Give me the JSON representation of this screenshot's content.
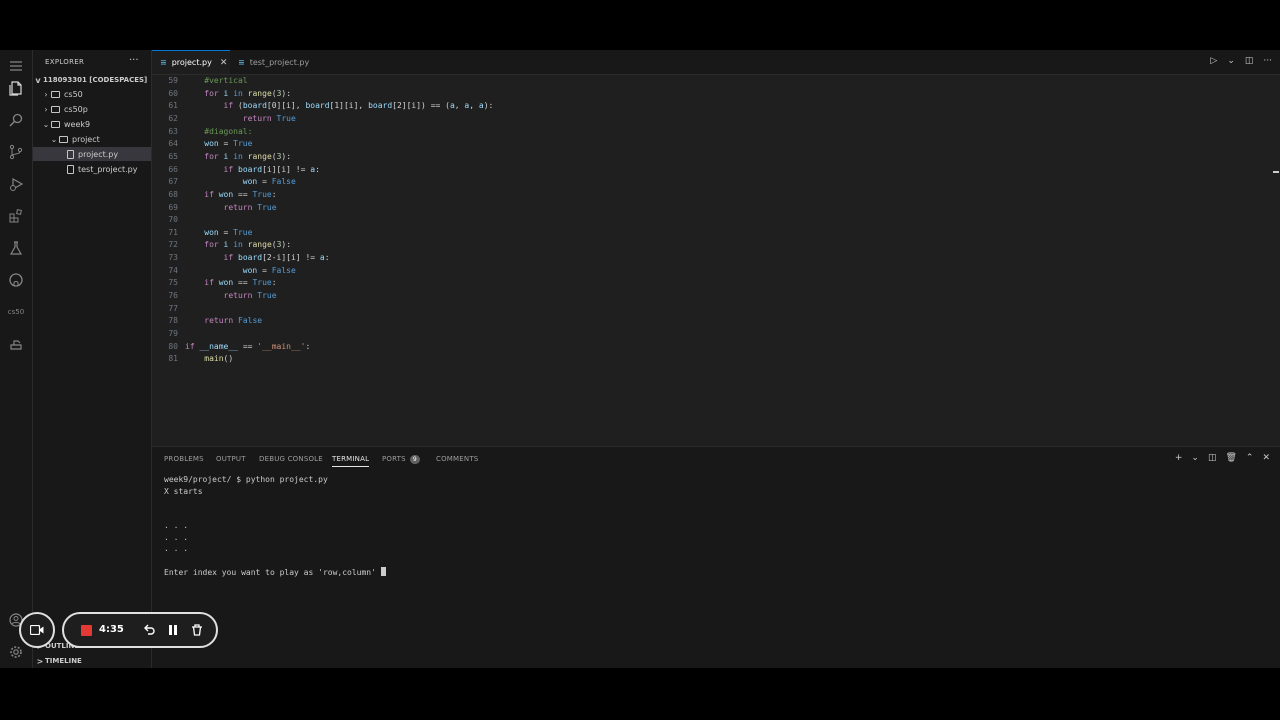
{
  "sidebar": {
    "title": "EXPLORER",
    "more": "···",
    "root": "118093301 [CODESPACES]",
    "items": [
      {
        "label": "cs50",
        "depth": 1,
        "kind": "folder",
        "chev": ">"
      },
      {
        "label": "cs50p",
        "depth": 1,
        "kind": "folder",
        "chev": ">"
      },
      {
        "label": "week9",
        "depth": 1,
        "kind": "folder",
        "chev": "v"
      },
      {
        "label": "project",
        "depth": 2,
        "kind": "folder",
        "chev": "v"
      },
      {
        "label": "project.py",
        "depth": 3,
        "kind": "file",
        "chev": ""
      },
      {
        "label": "test_project.py",
        "depth": 3,
        "kind": "file",
        "chev": ""
      }
    ],
    "outline": "OUTLINE",
    "timeline": "TIMELINE"
  },
  "activity": {
    "cs50_label": "cs50"
  },
  "tabs": [
    {
      "label": "project.py",
      "active": true,
      "close": "✕",
      "icon": "py"
    },
    {
      "label": "test_project.py",
      "active": false,
      "icon": "py"
    }
  ],
  "editor": {
    "lines": [
      {
        "n": "59",
        "tokens": [
          [
            "    ",
            "plain"
          ],
          [
            "#vertical",
            "cmt"
          ]
        ]
      },
      {
        "n": "60",
        "tokens": [
          [
            "    ",
            "plain"
          ],
          [
            "for",
            "kw"
          ],
          [
            " ",
            "plain"
          ],
          [
            "i",
            "var"
          ],
          [
            " ",
            "plain"
          ],
          [
            "in",
            "ctl"
          ],
          [
            " ",
            "plain"
          ],
          [
            "range",
            "fn"
          ],
          [
            "(",
            "plain"
          ],
          [
            "3",
            "num"
          ],
          [
            "):",
            "plain"
          ]
        ]
      },
      {
        "n": "61",
        "tokens": [
          [
            "        ",
            "plain"
          ],
          [
            "if",
            "kw"
          ],
          [
            " (",
            "plain"
          ],
          [
            "board",
            "var"
          ],
          [
            "[0][i], ",
            "plain"
          ],
          [
            "board",
            "var"
          ],
          [
            "[1][i], ",
            "plain"
          ],
          [
            "board",
            "var"
          ],
          [
            "[2][i]) == (",
            "plain"
          ],
          [
            "a",
            "var"
          ],
          [
            ", ",
            "plain"
          ],
          [
            "a",
            "var"
          ],
          [
            ", ",
            "plain"
          ],
          [
            "a",
            "var"
          ],
          [
            "):",
            "plain"
          ]
        ]
      },
      {
        "n": "62",
        "tokens": [
          [
            "            ",
            "plain"
          ],
          [
            "return",
            "kw"
          ],
          [
            " ",
            "plain"
          ],
          [
            "True",
            "ctl"
          ]
        ]
      },
      {
        "n": "63",
        "tokens": [
          [
            "    ",
            "plain"
          ],
          [
            "#diagonal:",
            "cmt"
          ]
        ]
      },
      {
        "n": "64",
        "tokens": [
          [
            "    ",
            "plain"
          ],
          [
            "won",
            "var"
          ],
          [
            " = ",
            "plain"
          ],
          [
            "True",
            "ctl"
          ]
        ]
      },
      {
        "n": "65",
        "tokens": [
          [
            "    ",
            "plain"
          ],
          [
            "for",
            "kw"
          ],
          [
            " ",
            "plain"
          ],
          [
            "i",
            "var"
          ],
          [
            " ",
            "plain"
          ],
          [
            "in",
            "ctl"
          ],
          [
            " ",
            "plain"
          ],
          [
            "range",
            "fn"
          ],
          [
            "(",
            "plain"
          ],
          [
            "3",
            "num"
          ],
          [
            "):",
            "plain"
          ]
        ]
      },
      {
        "n": "66",
        "tokens": [
          [
            "        ",
            "plain"
          ],
          [
            "if",
            "kw"
          ],
          [
            " ",
            "plain"
          ],
          [
            "board",
            "var"
          ],
          [
            "[i][i] != ",
            "plain"
          ],
          [
            "a",
            "var"
          ],
          [
            ":",
            "plain"
          ]
        ]
      },
      {
        "n": "67",
        "tokens": [
          [
            "            ",
            "plain"
          ],
          [
            "won",
            "var"
          ],
          [
            " = ",
            "plain"
          ],
          [
            "False",
            "ctl"
          ]
        ]
      },
      {
        "n": "68",
        "tokens": [
          [
            "    ",
            "plain"
          ],
          [
            "if",
            "kw"
          ],
          [
            " ",
            "plain"
          ],
          [
            "won",
            "var"
          ],
          [
            " == ",
            "plain"
          ],
          [
            "True",
            "ctl"
          ],
          [
            ":",
            "plain"
          ]
        ]
      },
      {
        "n": "69",
        "tokens": [
          [
            "        ",
            "plain"
          ],
          [
            "return",
            "kw"
          ],
          [
            " ",
            "plain"
          ],
          [
            "True",
            "ctl"
          ]
        ]
      },
      {
        "n": "70",
        "tokens": []
      },
      {
        "n": "71",
        "tokens": [
          [
            "    ",
            "plain"
          ],
          [
            "won",
            "var"
          ],
          [
            " = ",
            "plain"
          ],
          [
            "True",
            "ctl"
          ]
        ]
      },
      {
        "n": "72",
        "tokens": [
          [
            "    ",
            "plain"
          ],
          [
            "for",
            "kw"
          ],
          [
            " ",
            "plain"
          ],
          [
            "i",
            "var"
          ],
          [
            " ",
            "plain"
          ],
          [
            "in",
            "ctl"
          ],
          [
            " ",
            "plain"
          ],
          [
            "range",
            "fn"
          ],
          [
            "(",
            "plain"
          ],
          [
            "3",
            "num"
          ],
          [
            "):",
            "plain"
          ]
        ]
      },
      {
        "n": "73",
        "tokens": [
          [
            "        ",
            "plain"
          ],
          [
            "if",
            "kw"
          ],
          [
            " ",
            "plain"
          ],
          [
            "board",
            "var"
          ],
          [
            "[2-i][i] != ",
            "plain"
          ],
          [
            "a",
            "var"
          ],
          [
            ":",
            "plain"
          ]
        ]
      },
      {
        "n": "74",
        "tokens": [
          [
            "            ",
            "plain"
          ],
          [
            "won",
            "var"
          ],
          [
            " = ",
            "plain"
          ],
          [
            "False",
            "ctl"
          ]
        ]
      },
      {
        "n": "75",
        "tokens": [
          [
            "    ",
            "plain"
          ],
          [
            "if",
            "kw"
          ],
          [
            " ",
            "plain"
          ],
          [
            "won",
            "var"
          ],
          [
            " == ",
            "plain"
          ],
          [
            "True",
            "ctl"
          ],
          [
            ":",
            "plain"
          ]
        ]
      },
      {
        "n": "76",
        "tokens": [
          [
            "        ",
            "plain"
          ],
          [
            "return",
            "kw"
          ],
          [
            " ",
            "plain"
          ],
          [
            "True",
            "ctl"
          ]
        ]
      },
      {
        "n": "77",
        "tokens": []
      },
      {
        "n": "78",
        "tokens": [
          [
            "    ",
            "plain"
          ],
          [
            "return",
            "kw"
          ],
          [
            " ",
            "plain"
          ],
          [
            "False",
            "ctl"
          ]
        ]
      },
      {
        "n": "79",
        "tokens": []
      },
      {
        "n": "80",
        "tokens": [
          [
            "if",
            "kw"
          ],
          [
            " ",
            "plain"
          ],
          [
            "__name__",
            "var"
          ],
          [
            " == ",
            "plain"
          ],
          [
            "'__main__'",
            "str"
          ],
          [
            ":",
            "plain"
          ]
        ]
      },
      {
        "n": "81",
        "tokens": [
          [
            "    ",
            "plain"
          ],
          [
            "main",
            "fn"
          ],
          [
            "()",
            "plain"
          ]
        ]
      }
    ]
  },
  "panel": {
    "tabs": [
      {
        "label": "PROBLEMS",
        "active": false
      },
      {
        "label": "OUTPUT",
        "active": false
      },
      {
        "label": "DEBUG CONSOLE",
        "active": false
      },
      {
        "label": "TERMINAL",
        "active": true
      },
      {
        "label": "PORTS",
        "active": false,
        "badge": "9"
      },
      {
        "label": "COMMENTS",
        "active": false
      }
    ],
    "terminal_lines": [
      "week9/project/ $ python project.py",
      "X starts",
      "",
      "",
      ". . .",
      ". . .",
      ". . .",
      "",
      "Enter index you want to play as 'row,column' "
    ]
  },
  "recorder": {
    "time": "4:35"
  }
}
